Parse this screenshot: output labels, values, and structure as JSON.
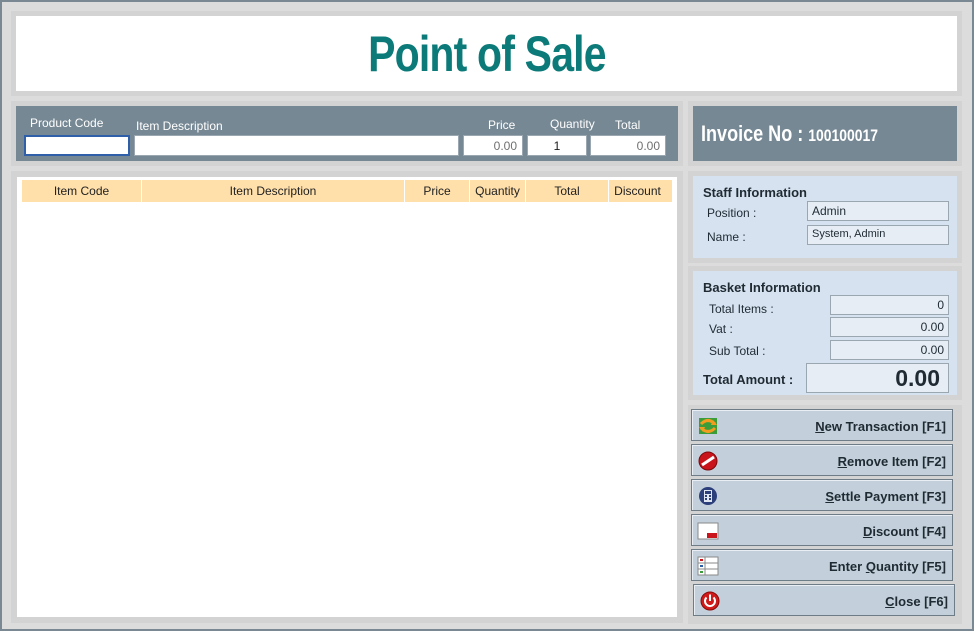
{
  "app_title": "Point of Sale",
  "entry": {
    "product_code_label": "Product Code",
    "item_description_label": "Item Description",
    "price_label": "Price",
    "quantity_label": "Quantity",
    "total_label": "Total",
    "product_code_value": "",
    "item_description_value": "",
    "price_value": "0.00",
    "quantity_value": "1",
    "total_value": "0.00"
  },
  "grid": {
    "columns": [
      "Item Code",
      "Item Description",
      "Price",
      "Quantity",
      "Total",
      "Discount"
    ],
    "rows": []
  },
  "invoice": {
    "label": "Invoice No :",
    "number": "100100017"
  },
  "staff": {
    "title": "Staff Information",
    "position_label": "Position :",
    "position_value": "Admin",
    "name_label": "Name :",
    "name_value": "System, Admin"
  },
  "basket": {
    "title": "Basket Information",
    "total_items_label": "Total Items :",
    "total_items_value": "0",
    "vat_label": "Vat :",
    "vat_value": "0.00",
    "sub_total_label": "Sub Total :",
    "sub_total_value": "0.00",
    "total_amount_label": "Total Amount :",
    "total_amount_value": "0.00"
  },
  "buttons": {
    "new_transaction": {
      "first": "N",
      "rest": "ew Transaction [F1]",
      "icon": "refresh-icon"
    },
    "remove_item": {
      "first": "R",
      "rest": "emove Item [F2]",
      "icon": "no-entry-icon"
    },
    "settle_payment": {
      "first": "S",
      "rest": "ettle Payment [F3]",
      "icon": "calculator-icon"
    },
    "discount": {
      "first": "D",
      "rest": "iscount [F4]",
      "icon": "discount-tag-icon"
    },
    "enter_quantity": {
      "pre": "Enter ",
      "first": "Q",
      "rest": "uantity [F5]",
      "icon": "quantity-icon"
    },
    "close": {
      "first": "C",
      "rest": "lose [F6]",
      "icon": "power-icon"
    }
  },
  "colors": {
    "title": "#0b7a78",
    "panel_header": "#768894",
    "grid_header": "#ffdfaa",
    "info_bg": "#d6e2ef"
  }
}
